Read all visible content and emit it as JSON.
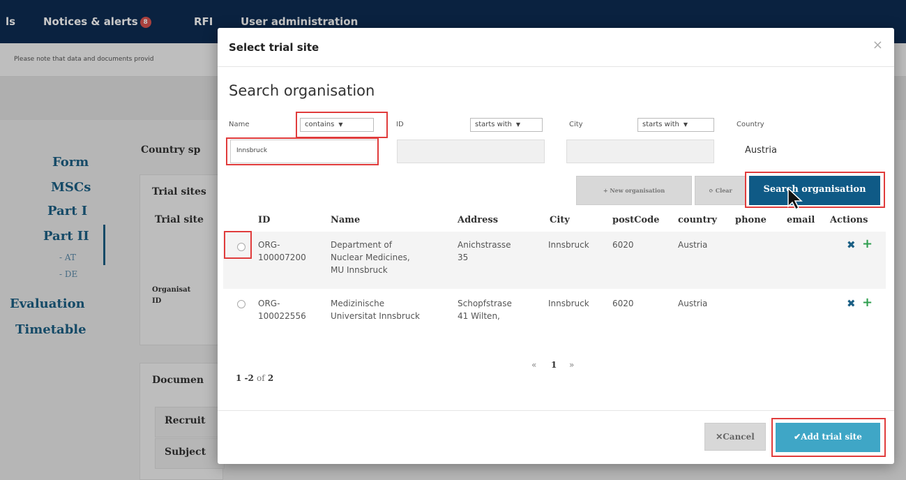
{
  "background": {
    "nav": {
      "item_partial": "ls",
      "notices": "Notices & alerts",
      "notices_count": "8",
      "rfi": "RFI",
      "user_admin": "User administration"
    },
    "notice_text": "Please note that data and documents provid",
    "side_nav": {
      "form": "Form",
      "mscs": "MSCs",
      "part1": "Part I",
      "part2": "Part II",
      "sub_at": "- AT",
      "sub_de": "- DE",
      "evaluation": "Evaluation",
      "timetable": "Timetable"
    },
    "country_label": "Country sp",
    "trial_sites_1": "Trial sites",
    "trial_sites_2": "Trial site",
    "organisation": "Organisat",
    "id_label": "ID",
    "documents": "Documen",
    "recruit": "Recruit",
    "subject": "Subject"
  },
  "modal": {
    "title": "Select trial site",
    "close": "×",
    "section_title": "Search organisation",
    "filters": {
      "name_label": "Name",
      "name_mode": "contains",
      "name_value": "Innsbruck",
      "id_label": "ID",
      "id_mode": "starts with",
      "city_label": "City",
      "city_mode": "starts with",
      "country_label": "Country",
      "country_value": "Austria"
    },
    "buttons": {
      "new_org": "+ New organisation",
      "clear": "⟳ Clear",
      "search": "Search organisation",
      "cancel": "✕Cancel",
      "add": "✔Add trial site"
    },
    "table": {
      "headers": [
        "ID",
        "Name",
        "Address",
        "City",
        "postCode",
        "country",
        "phone",
        "email",
        "Actions"
      ],
      "rows": [
        {
          "id_1": "ORG-",
          "id_2": "100007200",
          "name_1": "Department of",
          "name_2": "Nuclear Medicines,",
          "name_3": "MU Innsbruck",
          "address_1": "Anichstrasse",
          "address_2": "35",
          "city": "Innsbruck",
          "postcode": "6020",
          "country": "Austria"
        },
        {
          "id_1": "ORG-",
          "id_2": "100022556",
          "name_1": "Medizinische",
          "name_2": "Universitat Innsbruck",
          "address_1": "Schopfstrase",
          "address_2": "41 Wilten,",
          "city": "Innsbruck",
          "postcode": "6020",
          "country": "Austria"
        }
      ],
      "action_remove": "✖",
      "action_add": "+"
    },
    "pagination": {
      "prev": "«",
      "page": "1",
      "next": "»",
      "range": "1 -2",
      "of": "of",
      "total": "2"
    }
  },
  "colors": {
    "nav_bg": "#0d2c52",
    "primary": "#0f5a86",
    "add_button": "#3fa6c6",
    "highlight": "#e03c3c"
  }
}
